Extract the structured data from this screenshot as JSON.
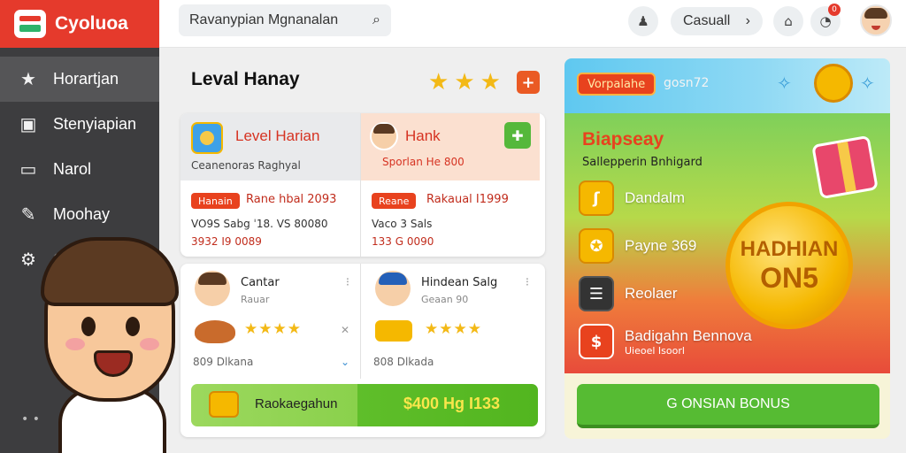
{
  "brand": {
    "name": "Cyoluoa"
  },
  "sidebar": {
    "items": [
      {
        "label": "Horartjan",
        "icon": "star-icon"
      },
      {
        "label": "Stenyiapian",
        "icon": "box-icon"
      },
      {
        "label": "Narol",
        "icon": "window-icon"
      },
      {
        "label": "Moohay",
        "icon": "pencil-icon"
      },
      {
        "label": "G",
        "icon": "settings-icon"
      }
    ],
    "dots": "•  •"
  },
  "header": {
    "search_value": "Ravanypian Mgnanalan",
    "casual_label": "Casuall",
    "notification_count": "0"
  },
  "main": {
    "title": "Leval Hanay",
    "level_card": {
      "title": "Level Harian",
      "subtitle": "Ceanenoras Raghyal",
      "chip": "Hanain",
      "chip_text": "Rane hbal 2093",
      "line1": "VO9S Sabg ˈ18. VS 80080",
      "line2": "3932 I9 0089"
    },
    "hank_card": {
      "title": "Hank",
      "subtitle": "Sporlan He 800",
      "chip": "Reane",
      "chip_text": "Rakaual I1999",
      "line1": "Vaco 3 Sals",
      "line2": "133 G 0090"
    },
    "players": [
      {
        "name": "Cantar",
        "rank": "Rauar ",
        "meta": "809 Dlkana",
        "stars": "★★★★"
      },
      {
        "name": "Hindean Salg",
        "rank": "Geaan 90",
        "meta": "808 Dlkada",
        "stars": "★★★★"
      }
    ],
    "action_bar": {
      "label": "Raokaegahun",
      "value": "$400 Hg I133"
    }
  },
  "promo": {
    "pill": "Vorpalahe",
    "pill_side": "gosn72",
    "title": "Biapseay",
    "subtitle": "Sallepperin Bnhigard",
    "rewards": [
      {
        "label": "Dandalm",
        "sub": ""
      },
      {
        "label": "Payne 369",
        "sub": ""
      },
      {
        "label": "Reolaer",
        "sub": ""
      },
      {
        "label": "Badigahn Bennova",
        "sub": "Uieoel Isoorl"
      }
    ],
    "coin_line1": "HADHIAN",
    "coin_line2": "ON5",
    "button": "G ONSIAN BONUS"
  },
  "colors": {
    "accent": "#e53a2c",
    "green": "#56bb33",
    "gold": "#f5b800"
  }
}
